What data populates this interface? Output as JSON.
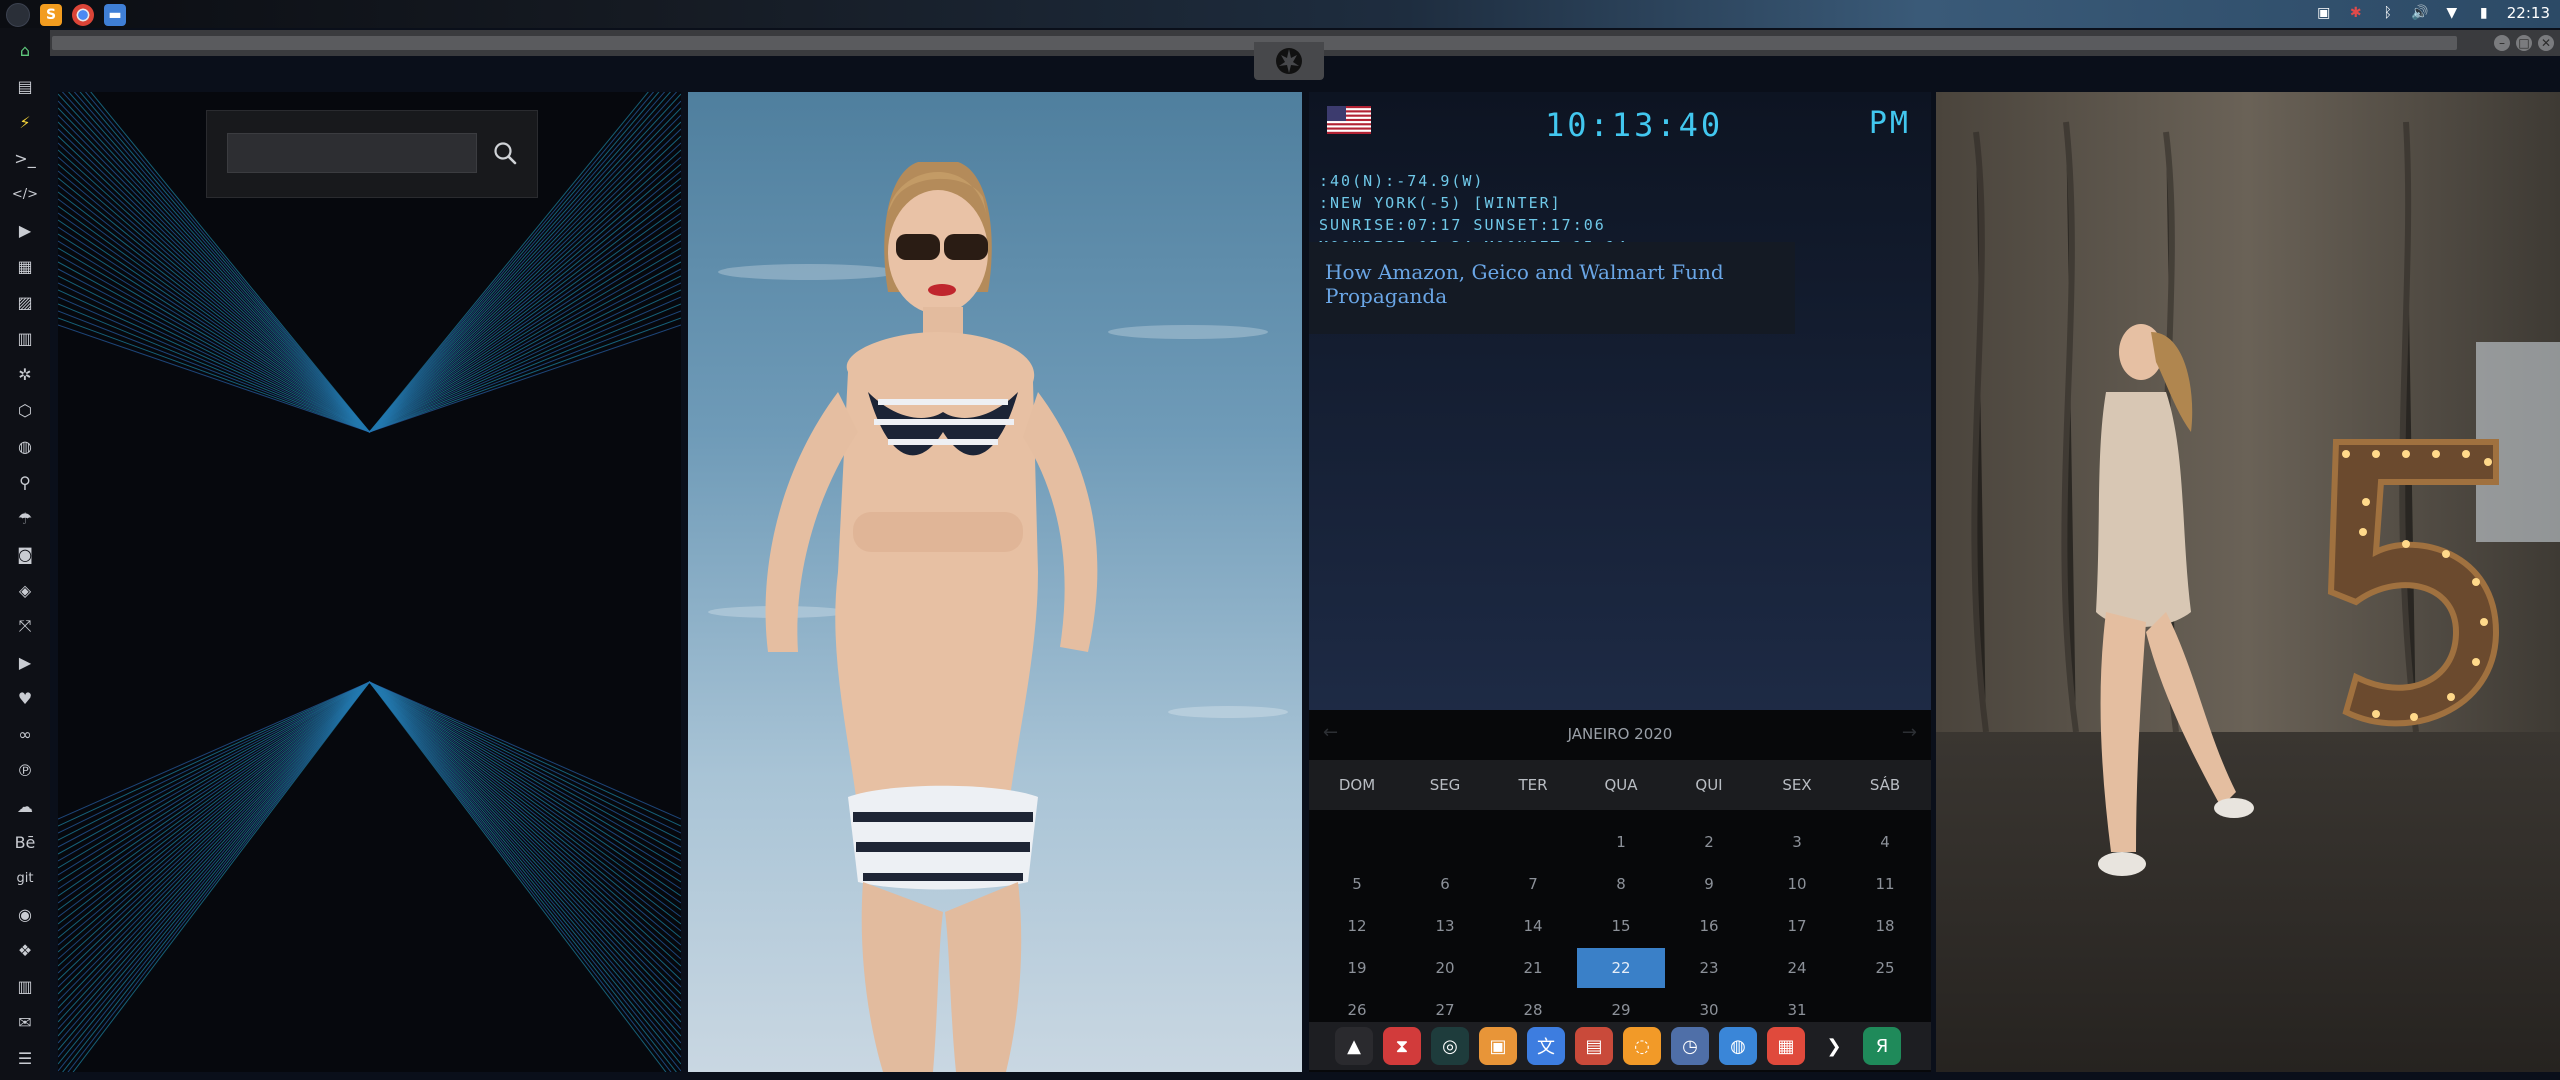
{
  "topbar": {
    "apps": [
      {
        "name": "launcher-icon"
      },
      {
        "name": "sublime-text-icon",
        "glyph": "S"
      },
      {
        "name": "chrome-icon",
        "glyph": ""
      },
      {
        "name": "files-icon",
        "glyph": "▬"
      }
    ],
    "tray": [
      "image-viewer-icon",
      "bug-icon",
      "bluetooth-icon",
      "volume-icon",
      "wifi-icon",
      "battery-icon"
    ],
    "tray_glyphs": [
      "▣",
      "✱",
      "ᛒ",
      "🔊",
      "▼",
      "▮"
    ],
    "clock": "22:13"
  },
  "window": {
    "controls": [
      "–",
      "□",
      "✕"
    ],
    "rebel_glyph": "✪"
  },
  "sidebar": {
    "items": [
      {
        "name": "home-icon",
        "glyph": "⌂"
      },
      {
        "name": "document-icon",
        "glyph": "▤"
      },
      {
        "name": "bolt-icon",
        "glyph": "⚡"
      },
      {
        "name": "terminal-icon",
        "glyph": ">_"
      },
      {
        "name": "code-icon",
        "glyph": "</>"
      },
      {
        "name": "play-icon",
        "glyph": "▶"
      },
      {
        "name": "media-icon",
        "glyph": "▦"
      },
      {
        "name": "image-icon",
        "glyph": "▨"
      },
      {
        "name": "news-icon",
        "glyph": "▥"
      },
      {
        "name": "settings-icon",
        "glyph": "✲"
      },
      {
        "name": "hexagon-icon",
        "glyph": "⬡"
      },
      {
        "name": "globe-icon",
        "glyph": "◍"
      },
      {
        "name": "search-icon",
        "glyph": "⚲"
      },
      {
        "name": "umbrella-icon",
        "glyph": "☂"
      },
      {
        "name": "contact-icon",
        "glyph": "◙"
      },
      {
        "name": "tag-icon",
        "glyph": "◈"
      },
      {
        "name": "expand-icon",
        "glyph": "⤧"
      },
      {
        "name": "youtube-icon",
        "glyph": "▶"
      },
      {
        "name": "heart-icon",
        "glyph": "♥"
      },
      {
        "name": "infinity-icon",
        "glyph": "∞"
      },
      {
        "name": "pinterest-icon",
        "glyph": "℗"
      },
      {
        "name": "cloud-icon",
        "glyph": "☁"
      },
      {
        "name": "behance-icon",
        "glyph": "Bē"
      },
      {
        "name": "git-icon",
        "glyph": "git"
      },
      {
        "name": "github-icon",
        "glyph": "◉"
      },
      {
        "name": "cubes-icon",
        "glyph": "❖"
      },
      {
        "name": "map-icon",
        "glyph": "▥"
      },
      {
        "name": "mail-icon",
        "glyph": "✉"
      },
      {
        "name": "list-icon",
        "glyph": "☰"
      }
    ]
  },
  "search": {
    "value": "",
    "placeholder": ""
  },
  "clock_widget": {
    "time": "10:13:40",
    "ampm": "PM",
    "lines": [
      ":40(N):-74.9(W)",
      ":NEW YORK(-5) [WINTER]",
      "SUNRISE:07:17 SUNSET:17:06",
      "MOONRISE:05:34 MOONSET:15:14"
    ],
    "news_title": "How Amazon, Geico and Walmart Fund Propaganda"
  },
  "calendar": {
    "month": "JANEIRO 2020",
    "prev": "←",
    "next": "→",
    "days_of_week": [
      "DOM",
      "SEG",
      "TER",
      "QUA",
      "QUI",
      "SEX",
      "SÁB"
    ],
    "first_weekday": 3,
    "days_in_month": 31,
    "today": 22,
    "today_color": "#3a80c8"
  },
  "dock": {
    "apps": [
      {
        "name": "adobe-icon",
        "glyph": "▲",
        "color": "#2a2a2e"
      },
      {
        "name": "timer-icon",
        "glyph": "⧗",
        "color": "#d23b3b"
      },
      {
        "name": "system-monitor-icon",
        "glyph": "◎",
        "color": "#1e3c3c"
      },
      {
        "name": "image-viewer-icon",
        "glyph": "▣",
        "color": "#e89538"
      },
      {
        "name": "translate-icon",
        "glyph": "文",
        "color": "#3d7de0"
      },
      {
        "name": "document-viewer-icon",
        "glyph": "▤",
        "color": "#c94a3a"
      },
      {
        "name": "search-app-icon",
        "glyph": "◌",
        "color": "#f29a28"
      },
      {
        "name": "clock-app-icon",
        "glyph": "◷",
        "color": "#4f6fa8"
      },
      {
        "name": "browser-icon",
        "glyph": "◍",
        "color": "#3a86d8"
      },
      {
        "name": "calendar-app-icon",
        "glyph": "▦",
        "color": "#e04a3c"
      },
      {
        "name": "arrow-app-icon",
        "glyph": "❯",
        "color": "#1d1e22"
      },
      {
        "name": "yandex-icon",
        "glyph": "Я",
        "color": "#1f8a5a"
      }
    ]
  }
}
